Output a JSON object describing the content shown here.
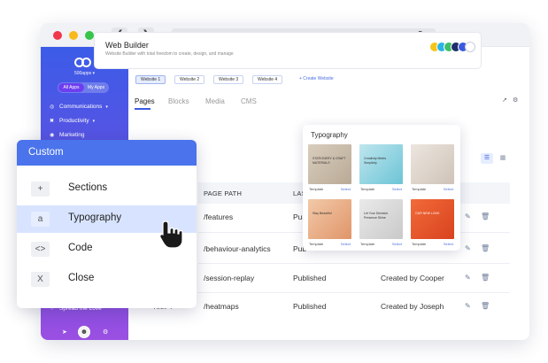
{
  "sidebar": {
    "workspace": "500apps",
    "tabs": [
      "All Apps",
      "My Apps"
    ],
    "items": [
      {
        "label": "Communications",
        "icon": "globe-icon"
      },
      {
        "label": "Productivity",
        "icon": "cross-icon"
      },
      {
        "label": "Marketing",
        "icon": "target-icon"
      },
      {
        "label": "Spread the Love",
        "icon": "heart-icon"
      }
    ]
  },
  "header": {
    "title": "Web Builder",
    "subtitle": "Website Builder with total freedom to create, design, and manage"
  },
  "website_tabs": [
    "Website 1",
    "Website 2",
    "Website 3",
    "Website 4"
  ],
  "create_website": "+ Create Website",
  "page_tabs": [
    "Pages",
    "Blocks",
    "Media",
    "CMS"
  ],
  "table": {
    "headers": [
      "PAGE PATH",
      "LAS"
    ],
    "rows": [
      {
        "path": "/features",
        "status": "Pub",
        "created": ""
      },
      {
        "path": "/behaviour-analytics",
        "status": "Pub",
        "created": ""
      },
      {
        "path": "/session-replay",
        "status": "Published",
        "created": "Created by Cooper"
      },
      {
        "prefix": "Test 4",
        "path": "/heatmaps",
        "status": "Published",
        "created": "Created by Joseph"
      }
    ]
  },
  "typography": {
    "title": "Typography",
    "cards": [
      {
        "text": "STATIONERY & CRAFT MATERIALS",
        "label": "Template",
        "select": "Select"
      },
      {
        "text": "Creativity Meets Simplicity",
        "label": "Template",
        "select": "Select"
      },
      {
        "text": "",
        "label": "Template",
        "select": "Select"
      },
      {
        "text": "Stay Beautiful",
        "label": "Template",
        "select": "Select"
      },
      {
        "text": "Let Your Decision Presence Shine",
        "label": "Template",
        "select": "Select"
      },
      {
        "text": "OUR NEW LOOK",
        "label": "Template",
        "select": "Select"
      }
    ]
  },
  "menu": {
    "title": "Custom",
    "items": [
      {
        "icon_glyph": "+",
        "label": "Sections"
      },
      {
        "icon_glyph": "a",
        "label": "Typography"
      },
      {
        "icon_glyph": "<>",
        "label": "Code"
      },
      {
        "icon_glyph": "X",
        "label": "Close"
      }
    ]
  },
  "colors": {
    "accent": "#4a73ec",
    "sidebar_top": "#3b5ce8",
    "sidebar_bottom": "#9a4fe2",
    "highlight": "#d8e4ff"
  }
}
